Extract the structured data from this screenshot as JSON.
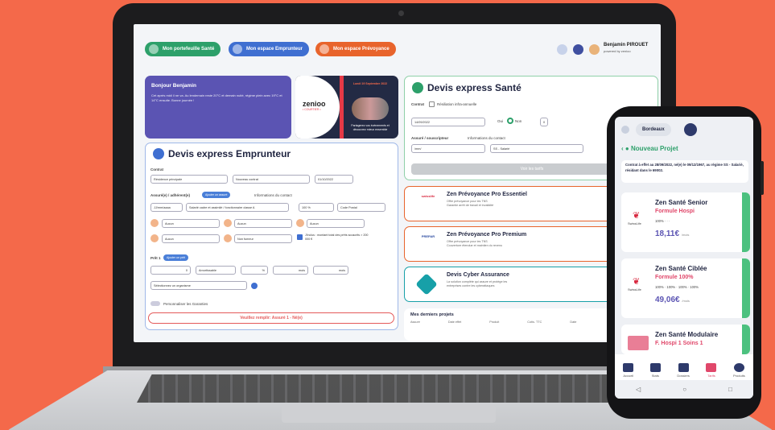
{
  "nav": {
    "buttons": [
      {
        "label": "Mon portefeuille Santé",
        "color": "#2da06a"
      },
      {
        "label": "Mon espace Emprunteur",
        "color": "#3f6fd1"
      },
      {
        "label": "Mon espace Prévoyance",
        "color": "#e8642c"
      }
    ],
    "user_name": "Benjamin PIROUET",
    "user_sub": "powered by zenioo"
  },
  "welcome": {
    "title": "Bonjour Benjamin",
    "text": "Cet après midi il ne va. Au lendemain reste 20°C et demain nuité, régime plein avec 19°C et 14°C ensuite. Bonne journée !"
  },
  "promo": {
    "logo": "zenioo",
    "logo_sub": "• COURTIER •",
    "headline": "Lundi 19 Septembre 2022",
    "footer": "Partagerez vos événements et découvrez mieux ensemble"
  },
  "emprunteur": {
    "title": "Devis express Emprunteur",
    "contrat_label": "Contrat",
    "fields": {
      "type_projet": "Résidence principale",
      "type_pret": "Nouveau contrat",
      "date_effet": "01/10/2022"
    },
    "assure_label": "Assuré(e) / adhérent(e)",
    "ajouter_assure": "Ajouter un assuré",
    "infos_label": "Informations du contact",
    "nais": "JJ/mm/aaaa",
    "profession": "Salarié cadre et assimilé / fonctionnaire classe A",
    "quotite": "100 %",
    "code_postal": "Code Postal",
    "fumeur": "Non fumeur",
    "aucun": "Aucun",
    "checkbox_text": "J'inclus : montant total des prêts souscrits > 200 000 €",
    "pret_label": "Prêt 1",
    "ajouter_pret": "Ajouter un prêt",
    "montant": "0",
    "type_pret2": "Amortissable",
    "taux": "%",
    "duree": "mois",
    "differe": "mois",
    "organisme": "Sélectionnez un organisme",
    "garanties": "Personnaliser les Garanties",
    "warning": "Veuillez remplir: Assuré 1 - Né(e)"
  },
  "sante": {
    "title": "Devis express Santé",
    "contrat_label": "Contrat",
    "resiliation": "Résiliation infra-annuelle",
    "date_effet": "14/09/2022",
    "conjoint": "Oui",
    "conjoint_no": "Non",
    "enfants": "0",
    "assure_label": "Assuré / souscripteur",
    "infos_contact": "Informations du contact",
    "nais": "/mm/",
    "regime": "SS - Salarié",
    "button": "Voir les tarifs"
  },
  "products": [
    {
      "name": "Zen Prévoyance Pro Essentiel",
      "logo": "swisslife",
      "desc": "Offre prévoyance pour les TNS\nGarantie arrêt de travail et invalidité",
      "color": "#e8642c"
    },
    {
      "name": "Zen Prévoyance Pro Premium",
      "logo": "PREPAR",
      "desc": "Offre prévoyance pour les TNS\nCouverture étendue et maintien du revenu",
      "color": "#e8642c"
    },
    {
      "name": "Devis Cyber Assurance",
      "logo": "",
      "desc": "La solution complète qui assure et protège les\nentreprises contre les cyberattaques",
      "color": "#17a0a8"
    }
  ],
  "projects": {
    "title": "Mes derniers projets",
    "columns": [
      "Assuré",
      "Date effet",
      "Produit",
      "Cotis. TTC",
      "Date"
    ]
  },
  "phone": {
    "location": "Bordeaux",
    "title": "Nouveau Projet",
    "contract": "Contrat à effet au 28/09/2022, né(e) le 09/12/1967, au régime SS - Salarié, résidant dans le 69002.",
    "offers": [
      {
        "name": "Zen Santé Senior",
        "formula": "Formule Hospi",
        "badges": "100%  ·  ·  ·",
        "price": "18,11€",
        "unit": "/mois",
        "brand": "SwissLife"
      },
      {
        "name": "Zen Santé Ciblée",
        "formula": "Formule 100%",
        "badges": "100%  ·  100%  ·  100%  ·  100%",
        "price": "49,06€",
        "unit": "/mois",
        "brand": "SwissLife"
      },
      {
        "name": "Zen Santé Modulaire",
        "formula": "F. Hospi 1 Soins 1",
        "badges": "",
        "price": "",
        "unit": "",
        "brand": ""
      }
    ],
    "nav": [
      "Accueil",
      "Stats",
      "Dossiers",
      "Tarifs",
      "Produits"
    ],
    "sys": [
      "◁",
      "○",
      "□"
    ]
  }
}
